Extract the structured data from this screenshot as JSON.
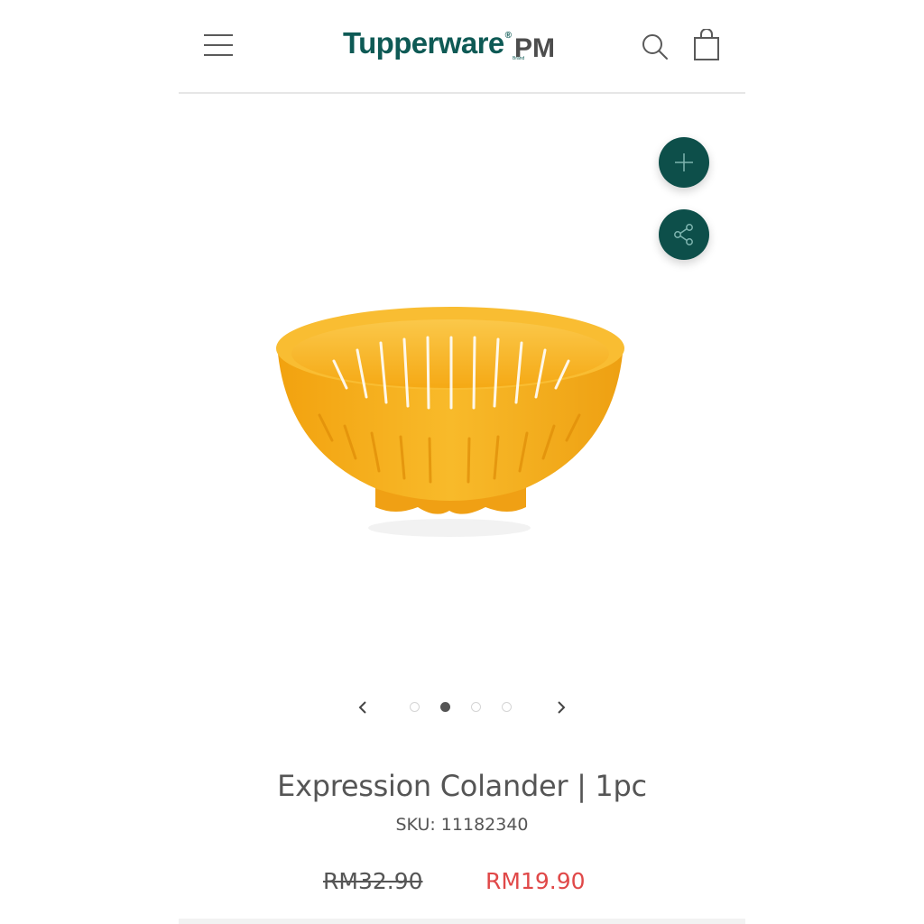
{
  "header": {
    "logo_word": "Tupperware",
    "logo_reg": "®",
    "logo_brand": "Brand",
    "logo_suffix": "PM"
  },
  "icons": {
    "menu": "menu-icon",
    "search": "search-icon",
    "bag": "shopping-bag-icon",
    "add": "plus-icon",
    "share": "share-icon",
    "prev": "chevron-left-icon",
    "next": "chevron-right-icon"
  },
  "gallery": {
    "dot_count": 4,
    "active_index": 1
  },
  "product": {
    "title": "Expression Colander | 1pc",
    "sku": "SKU: 11182340",
    "price_original": "RM32.90",
    "price_sale": "RM19.90"
  },
  "colors": {
    "brand": "#0e5a55",
    "fab": "#0d4f4a",
    "sale": "#e04848",
    "product": "#f7b21c"
  }
}
